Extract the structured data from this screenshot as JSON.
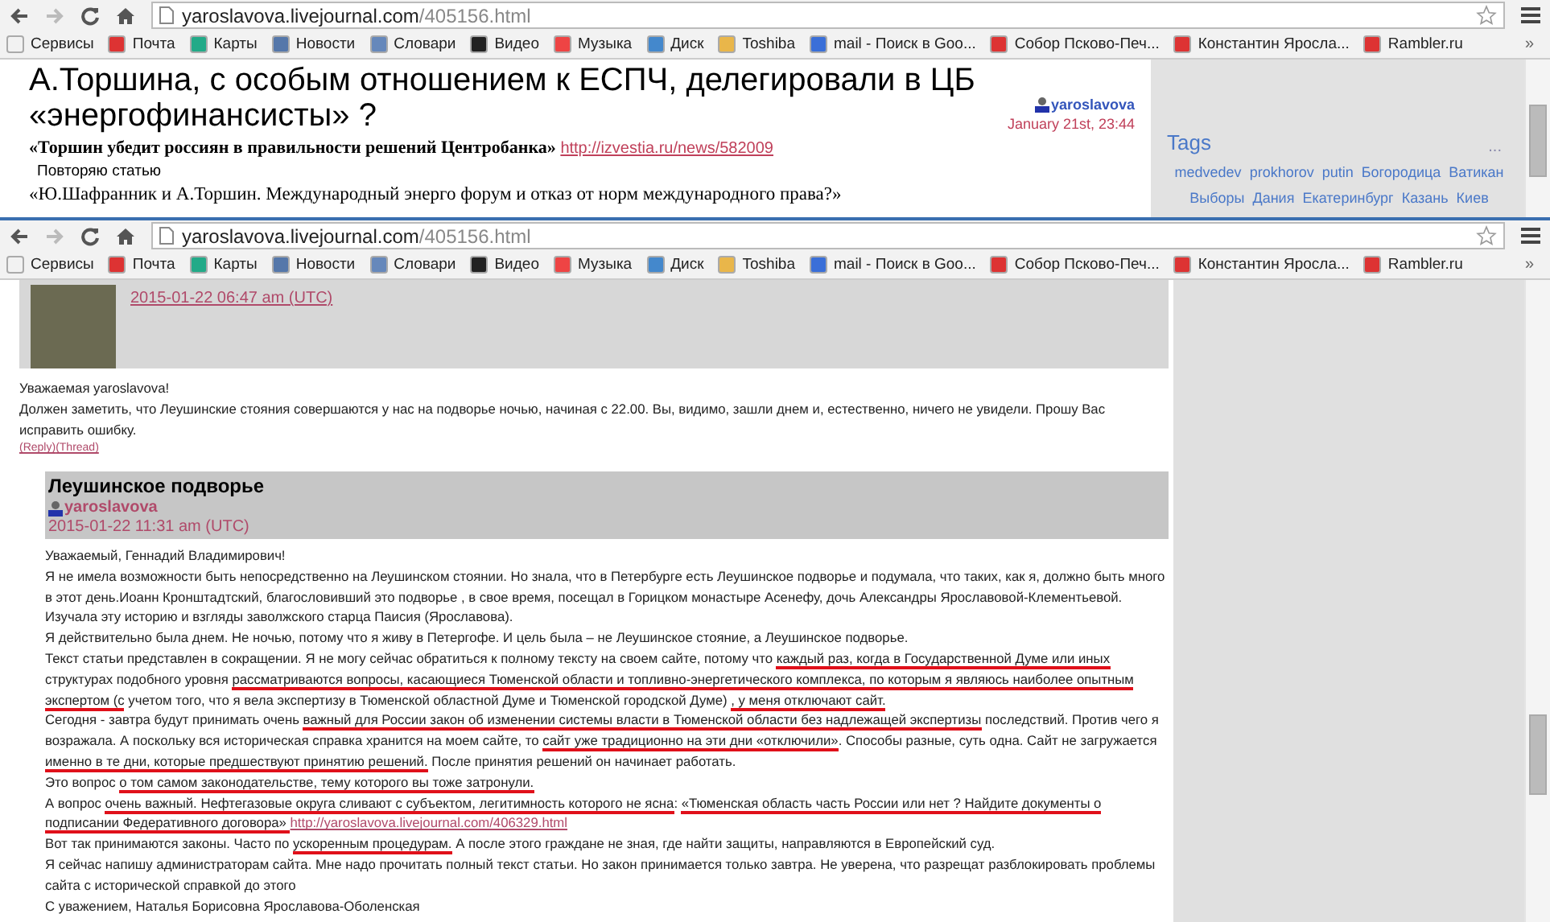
{
  "back_window": {
    "url_host": "yaroslavova.livejournal.com",
    "url_path": "/405156.html",
    "bookmarks": [
      "Сервисы",
      "Почта",
      "Карты",
      "Новости",
      "Словари",
      "Видео",
      "Музыка",
      "Диск",
      "Toshiba",
      "mail - Поиск в Goo...",
      "Собор Псково-Печ...",
      "Константин Яросла...",
      "Rambler.ru"
    ],
    "bookmarks_more": "»",
    "post_title": "А.Торшина, с особым отношением к ЕСПЧ, делегировали в ЦБ «энергофинансисты» ?",
    "author": "yaroslavova",
    "date": "January 21st, 23:44",
    "quote": "«Торшин убедит россиян в правильности решений Центробанка»",
    "quote_link": "http://izvestia.ru/news/582009",
    "note": "Повторяю статью",
    "line": "«Ю.Шафранник и А.Торшин. Международный энерго форум и отказ от норм международного права?»",
    "tags_title": "Tags",
    "tags_more": "...",
    "tags": [
      "medvedev",
      "prokhorov",
      "putin",
      "Богородица",
      "Ватикан",
      "Выборы",
      "Дания",
      "Екатеринбург",
      "Казань",
      "Киев"
    ]
  },
  "front_window": {
    "url_host": "yaroslavova.livejournal.com",
    "url_path": "/405156.html",
    "bookmarks": [
      "Сервисы",
      "Почта",
      "Карты",
      "Новости",
      "Словари",
      "Видео",
      "Музыка",
      "Диск",
      "Toshiba",
      "mail - Поиск в Goo...",
      "Собор Псково-Печ...",
      "Константин Яросла...",
      "Rambler.ru"
    ],
    "bookmarks_more": "»",
    "comment": {
      "date": "2015-01-22 06:47 am (UTC)",
      "lines": [
        "Уважаемая yaroslavova!",
        "Должен заметить, что Леушинские стояния совершаются у нас на подворье ночью, начиная с 22.00. Вы, видимо, зашли днем и, естественно, ничего не увидели. Прошу Вас",
        "исправить ошибку."
      ],
      "links": [
        "(Reply)",
        "(Thread)"
      ]
    },
    "reply": {
      "title": "Леушинское подворье",
      "author": "yaroslavova",
      "date": "2015-01-22 11:31 am (UTC)",
      "lines": [
        [
          {
            "kind": "text",
            "text": "Уважаемый, Геннадий Владимирович!"
          }
        ],
        [
          {
            "kind": "text",
            "text": "Я не имела возможности быть непосредственно на Леушинском стоянии. Но знала, что в Петербурге есть Леушинское подворье и подумала, что таких, как я, должно быть много"
          }
        ],
        [
          {
            "kind": "text",
            "text": "в этот день.Иоанн Кронштадтский, благословивший это подворье , в свое время, посещал в Горицком монастыре Асенефу, дочь Александры Ярославовой-Клементьевой."
          }
        ],
        [
          {
            "kind": "text",
            "text": "Изучала эту историю и взгляды заволжского старца Паисия (Ярославова)."
          }
        ],
        [
          {
            "kind": "text",
            "text": "Я действительно была днем. Не ночью, потому что я живу в Петергофе. И цель была – не Леушинское стояние, а Леушинское подворье."
          }
        ],
        [
          {
            "kind": "text",
            "text": "Текст статьи представлен в сокращении. Я не могу сейчас обратиться к полному тексту на своем сайте, потому что "
          },
          {
            "kind": "underlined",
            "text": "каждый раз, когда в Государственной Думе или иных"
          }
        ],
        [
          {
            "kind": "text",
            "text": "структурах подобного уровня "
          },
          {
            "kind": "underlined",
            "text": "рассматриваются вопросы, касающиеся Тюменской области и топливно-энергетического комплекса, по которым я являюсь наиболее опытным"
          }
        ],
        [
          {
            "kind": "underlined",
            "text": "экспертом (с"
          },
          {
            "kind": "text",
            "text": " учетом того, что я вела экспертизу в Тюменской областной Думе и Тюменской городской Думе) "
          },
          {
            "kind": "underlined",
            "text": ", у меня отключают сайт."
          }
        ],
        [
          {
            "kind": "text",
            "text": "Сегодня - завтра будут принимать очень "
          },
          {
            "kind": "underlined",
            "text": "важный для России закон об изменении системы власти в Тюменской области без надлежащей экспертизы"
          },
          {
            "kind": "text",
            "text": " последствий. Против чего я"
          }
        ],
        [
          {
            "kind": "text",
            "text": "возражала. А поскольку вся историческая справка хранится на моем сайте, то "
          },
          {
            "kind": "underlined",
            "text": "сайт уже традиционно на эти дни «отключили»"
          },
          {
            "kind": "text",
            "text": ". Способы разные, суть одна. Сайт не загружается"
          }
        ],
        [
          {
            "kind": "underlined",
            "text": "именно в те дни, которые предшествуют принятию решений."
          },
          {
            "kind": "text",
            "text": " После принятия решений он начинает работать."
          }
        ],
        [
          {
            "kind": "text",
            "text": "Это вопрос "
          },
          {
            "kind": "underlined",
            "text": "о том самом законодательстве, тему которого вы тоже затронули."
          }
        ],
        [
          {
            "kind": "text",
            "text": "А вопрос "
          },
          {
            "kind": "underlined",
            "text": "очень важный. Нефтегазовые округа сливают с субъектом, легитимность которого не ясна"
          },
          {
            "kind": "text",
            "text": ": "
          },
          {
            "kind": "underlined",
            "text": "«Тюменская область часть России или нет ? Найдите документы о"
          }
        ],
        [
          {
            "kind": "underlined",
            "text": "подписании Федеративного договора» "
          },
          {
            "kind": "link",
            "text": "http://yaroslavova.livejournal.com/406329.html"
          }
        ],
        [
          {
            "kind": "text",
            "text": "Вот так принимаются законы. Часто по "
          },
          {
            "kind": "underlined",
            "text": "ускоренным процедурам."
          },
          {
            "kind": "text",
            "text": " А после этого граждане не зная, где найти защиты, направляются в Европейский суд."
          }
        ],
        [
          {
            "kind": "text",
            "text": "Я сейчас напишу администраторам сайта. Мне надо прочитать полный текст статьи. Но закон принимается только завтра. Не уверена, что разрещат разблокировать проблемы"
          }
        ],
        [
          {
            "kind": "text",
            "text": "сайта с исторической справкой до этого"
          }
        ],
        [
          {
            "kind": "text",
            "text": "С уважением, Наталья Борисовна Ярославова-Оболенская"
          }
        ]
      ]
    }
  }
}
